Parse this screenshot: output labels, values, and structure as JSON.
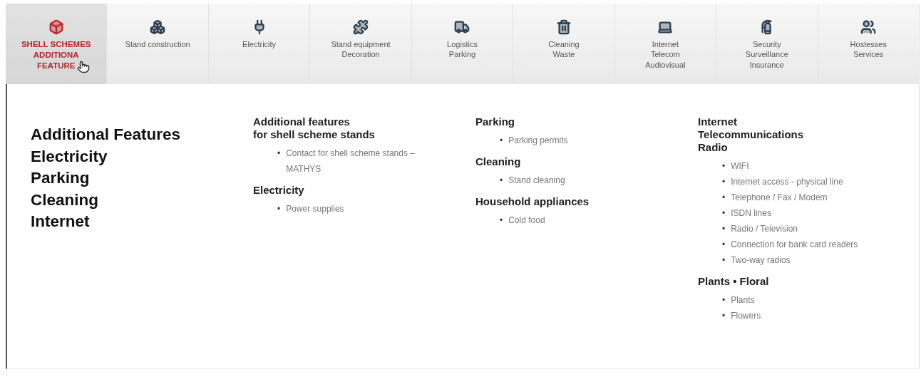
{
  "tabs": [
    {
      "label": [
        "SHELL SCHEMES",
        "ADDITIONA",
        "FEATURE"
      ],
      "kind": "box",
      "selected": true
    },
    {
      "label": [
        "Stand construction"
      ],
      "kind": "boxes",
      "selected": false
    },
    {
      "label": [
        "Electricity"
      ],
      "kind": "plug",
      "selected": false
    },
    {
      "label": [
        "Stand equipment",
        "Decoration"
      ],
      "kind": "puzzle",
      "selected": false
    },
    {
      "label": [
        "Logistics",
        "Parking"
      ],
      "kind": "truck",
      "selected": false
    },
    {
      "label": [
        "Cleaning",
        "Waste"
      ],
      "kind": "trash",
      "selected": false
    },
    {
      "label": [
        "Internet",
        "Telecom",
        "Audiovisual"
      ],
      "kind": "laptop",
      "selected": false
    },
    {
      "label": [
        "Security",
        "Surveillance",
        "Insurance"
      ],
      "kind": "extinguisher",
      "selected": false
    },
    {
      "label": [
        "Hostesses",
        "Services"
      ],
      "kind": "users",
      "selected": false
    }
  ],
  "bullet": "•",
  "overview": [
    "Additional Features",
    "Electricity",
    "Parking",
    "Cleaning",
    "Internet"
  ],
  "columns": [
    {
      "sections": [
        {
          "title": [
            "Additional features",
            "for shell scheme stands"
          ],
          "links": [
            "Contact for shell scheme stands – MATHYS"
          ]
        },
        {
          "title": [
            "Electricity"
          ],
          "links": [
            "Power supplies"
          ]
        }
      ]
    },
    {
      "sections": [
        {
          "title": [
            "Parking"
          ],
          "links": [
            "Parking permits"
          ]
        },
        {
          "title": [
            "Cleaning"
          ],
          "links": [
            "Stand cleaning"
          ]
        },
        {
          "title": [
            "Household appliances"
          ],
          "links": [
            "Cold food"
          ]
        }
      ]
    },
    {
      "sections": [
        {
          "title": [
            "Internet",
            "Telecommunications",
            "Radio"
          ],
          "links": [
            "WIFI",
            "Internet access - physical line",
            "Telephone / Fax / Modem",
            "ISDN lines",
            "Radio / Television",
            "Connection for bank card readers",
            "Two-way radios"
          ]
        },
        {
          "title": [
            "Plants • Floral"
          ],
          "links": [
            "Plants",
            "Flowers"
          ]
        }
      ]
    }
  ]
}
